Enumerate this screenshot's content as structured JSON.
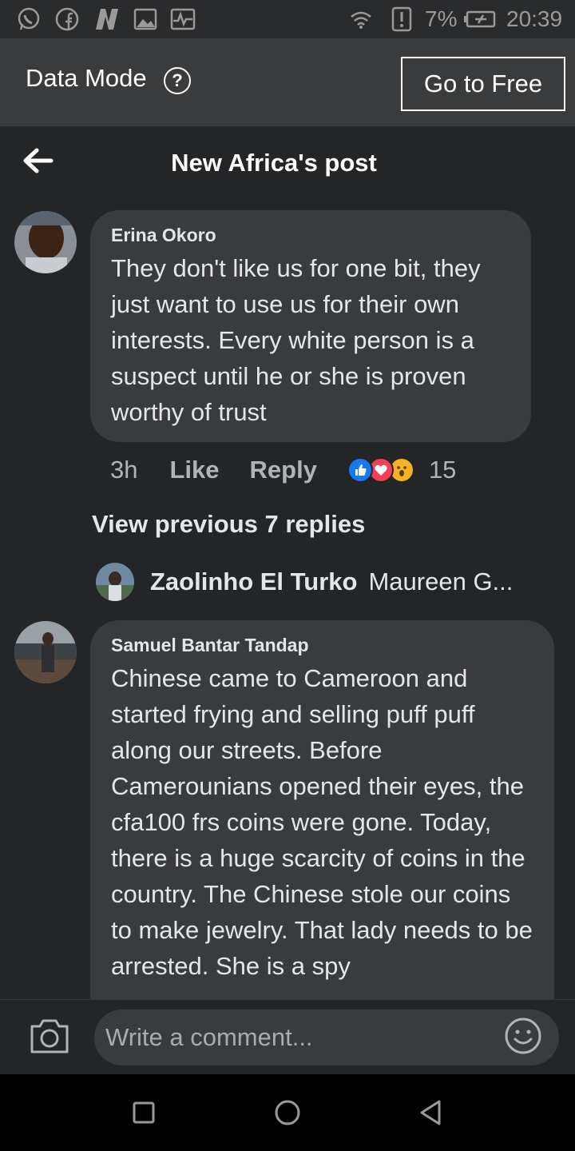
{
  "status_bar": {
    "battery": "7%",
    "time": "20:39",
    "icons": [
      "whatsapp-icon",
      "facebook-icon",
      "n-app-icon",
      "gallery-icon",
      "activity-icon",
      "wifi-icon",
      "alert-icon",
      "battery-icon"
    ]
  },
  "data_bar": {
    "label": "Data Mode",
    "help_icon": "?",
    "go_free_label": "Go to Free"
  },
  "header": {
    "title": "New Africa's post"
  },
  "comments": [
    {
      "author": "Erina Okoro",
      "text": "They don't like us for one bit, they just want to use us for their own interests. Every white person is a suspect until he or she is proven worthy of trust",
      "time": "3h",
      "like_label": "Like",
      "reply_label": "Reply",
      "reaction_count": "15",
      "reactions": [
        "like",
        "love",
        "wow"
      ]
    },
    {
      "author": "Samuel Bantar Tandap",
      "text": "Chinese came to Cameroon and started frying and selling puff puff along our streets. Before Camerounians opened their eyes, the cfa100 frs coins were gone. Today, there is a huge scarcity of coins in the country. The Chinese stole our coins to make jewelry. That lady needs to be arrested. She is a spy"
    }
  ],
  "replies": {
    "view_previous": "View previous 7 replies",
    "latest_name": "Zaolinho El Turko",
    "latest_preview": "Maureen G..."
  },
  "composer": {
    "placeholder": "Write a comment..."
  },
  "colors": {
    "background": "#242526",
    "bubble": "#3a3b3c",
    "like_blue": "#1877f2",
    "love_red": "#f33e58",
    "wow_yellow": "#f7b125"
  }
}
